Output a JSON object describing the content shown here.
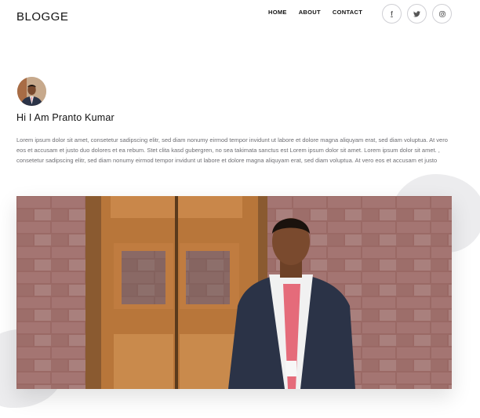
{
  "header": {
    "brand": "BLOGGE",
    "nav": [
      {
        "label": "HOME"
      },
      {
        "label": "ABOUT"
      },
      {
        "label": "CONTACT"
      }
    ],
    "social": [
      {
        "icon": "facebook-icon",
        "glyph": "f"
      },
      {
        "icon": "twitter-icon"
      },
      {
        "icon": "instagram-icon"
      }
    ]
  },
  "profile": {
    "headline": "Hi I Am Pranto Kumar",
    "bio": "Lorem ipsum dolor sit amet, consetetur sadipscing elitr, sed diam nonumy eirmod tempor invidunt ut labore et dolore magna aliquyam erat, sed diam voluptua. At vero eos et accusam et justo duo dolores et ea rebum. Stet clita kasd gubergren, no sea takimata sanctus est Lorem ipsum dolor sit amet. Lorem ipsum dolor sit amet. , consetetur sadipscing elitr, sed diam nonumy eirmod tempor invidunt ut labore et dolore magna aliquyam erat, sed diam voluptua. At vero eos et accusam et justo"
  },
  "colors": {
    "brick": "#9b6a66",
    "door": "#b8763a",
    "suit": "#2b3347",
    "tie": "#e56b7a",
    "text_muted": "#6e6e73"
  }
}
